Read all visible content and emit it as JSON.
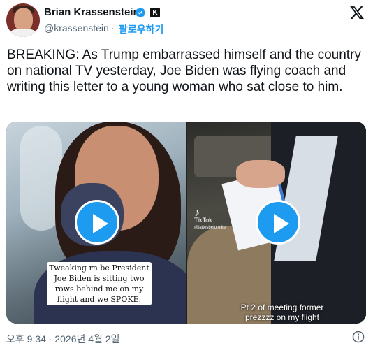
{
  "header": {
    "display_name": "Brian Krassenstein",
    "handle": "@krassenstein",
    "separator": "·",
    "follow_label": "팔로우하기",
    "verified_badge_color": "#1d9bf0",
    "affiliation_badge_label": "K"
  },
  "tweet": {
    "text": "BREAKING: As Trump embarrassed himself and the country on national TV yesterday, Joe Biden was flying coach and writing this letter to a young woman who sat close to him."
  },
  "media": [
    {
      "caption": "Tweaking rn be President Joe Biden is sitting two rows behind me on my flight and we SPOKE."
    },
    {
      "tiktok_label": "TikTok",
      "tiktok_user": "@lattesbeforelite",
      "caption": "Pt 2 of meeting former prezzzz on my flight"
    }
  ],
  "footer": {
    "timestamp": "오후 9:34 · 2026년 4월 2일"
  },
  "colors": {
    "accent": "#1d9bf0",
    "text": "#0f1419",
    "secondary_text": "#536471"
  }
}
